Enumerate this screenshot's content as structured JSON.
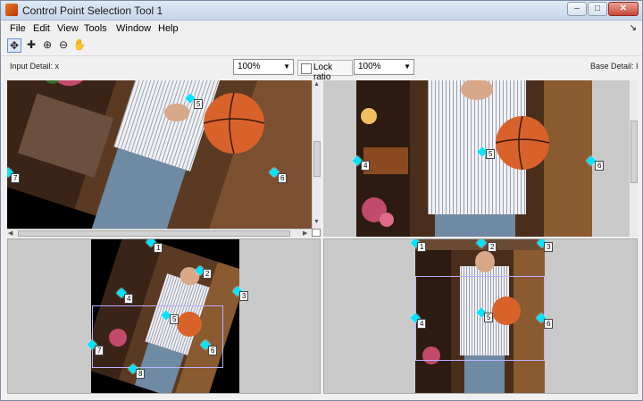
{
  "window": {
    "title": "Control Point Selection Tool 1"
  },
  "titlebar_buttons": {
    "minimize": "–",
    "maximize": "□",
    "close": "✕"
  },
  "menu": [
    {
      "label": "File"
    },
    {
      "label": "Edit"
    },
    {
      "label": "View"
    },
    {
      "label": "Tools"
    },
    {
      "label": "Window"
    },
    {
      "label": "Help"
    }
  ],
  "menu_dock_glyph": "↘",
  "toolbar": [
    {
      "icon": "add-point-icon",
      "glyph": "✥",
      "active": true
    },
    {
      "icon": "add-predict-point-icon",
      "glyph": "✚"
    },
    {
      "icon": "zoom-in-icon",
      "glyph": "⊕"
    },
    {
      "icon": "zoom-out-icon",
      "glyph": "⊖"
    },
    {
      "icon": "pan-hand-icon",
      "glyph": "✋"
    }
  ],
  "controls": {
    "input_detail_label": "Input Detail: x",
    "input_zoom": "100%",
    "lock_ratio_label": "Lock ratio",
    "base_zoom": "100%",
    "base_detail_label": "Base Detail: I",
    "dropdown_arrow": "▼"
  },
  "scrollbar_arrows": {
    "up": "▲",
    "down": "▼",
    "left": "◀",
    "right": "▶"
  },
  "points": {
    "input_detail": [
      {
        "label": "5"
      },
      {
        "label": "6"
      },
      {
        "label": "7"
      }
    ],
    "base_detail": [
      {
        "label": "4"
      },
      {
        "label": "5"
      },
      {
        "label": "6"
      }
    ],
    "input_overview": [
      {
        "label": "1"
      },
      {
        "label": "2"
      },
      {
        "label": "3"
      },
      {
        "label": "4"
      },
      {
        "label": "5"
      },
      {
        "label": "6"
      },
      {
        "label": "7"
      },
      {
        "label": "8"
      }
    ],
    "base_overview": [
      {
        "label": "1"
      },
      {
        "label": "2"
      },
      {
        "label": "3"
      },
      {
        "label": "4"
      },
      {
        "label": "5"
      },
      {
        "label": "6"
      }
    ]
  },
  "colors": {
    "marker": "#00e5ff",
    "panel_background": "#c9c9c9",
    "detail_rect": "#b9b0ff"
  }
}
